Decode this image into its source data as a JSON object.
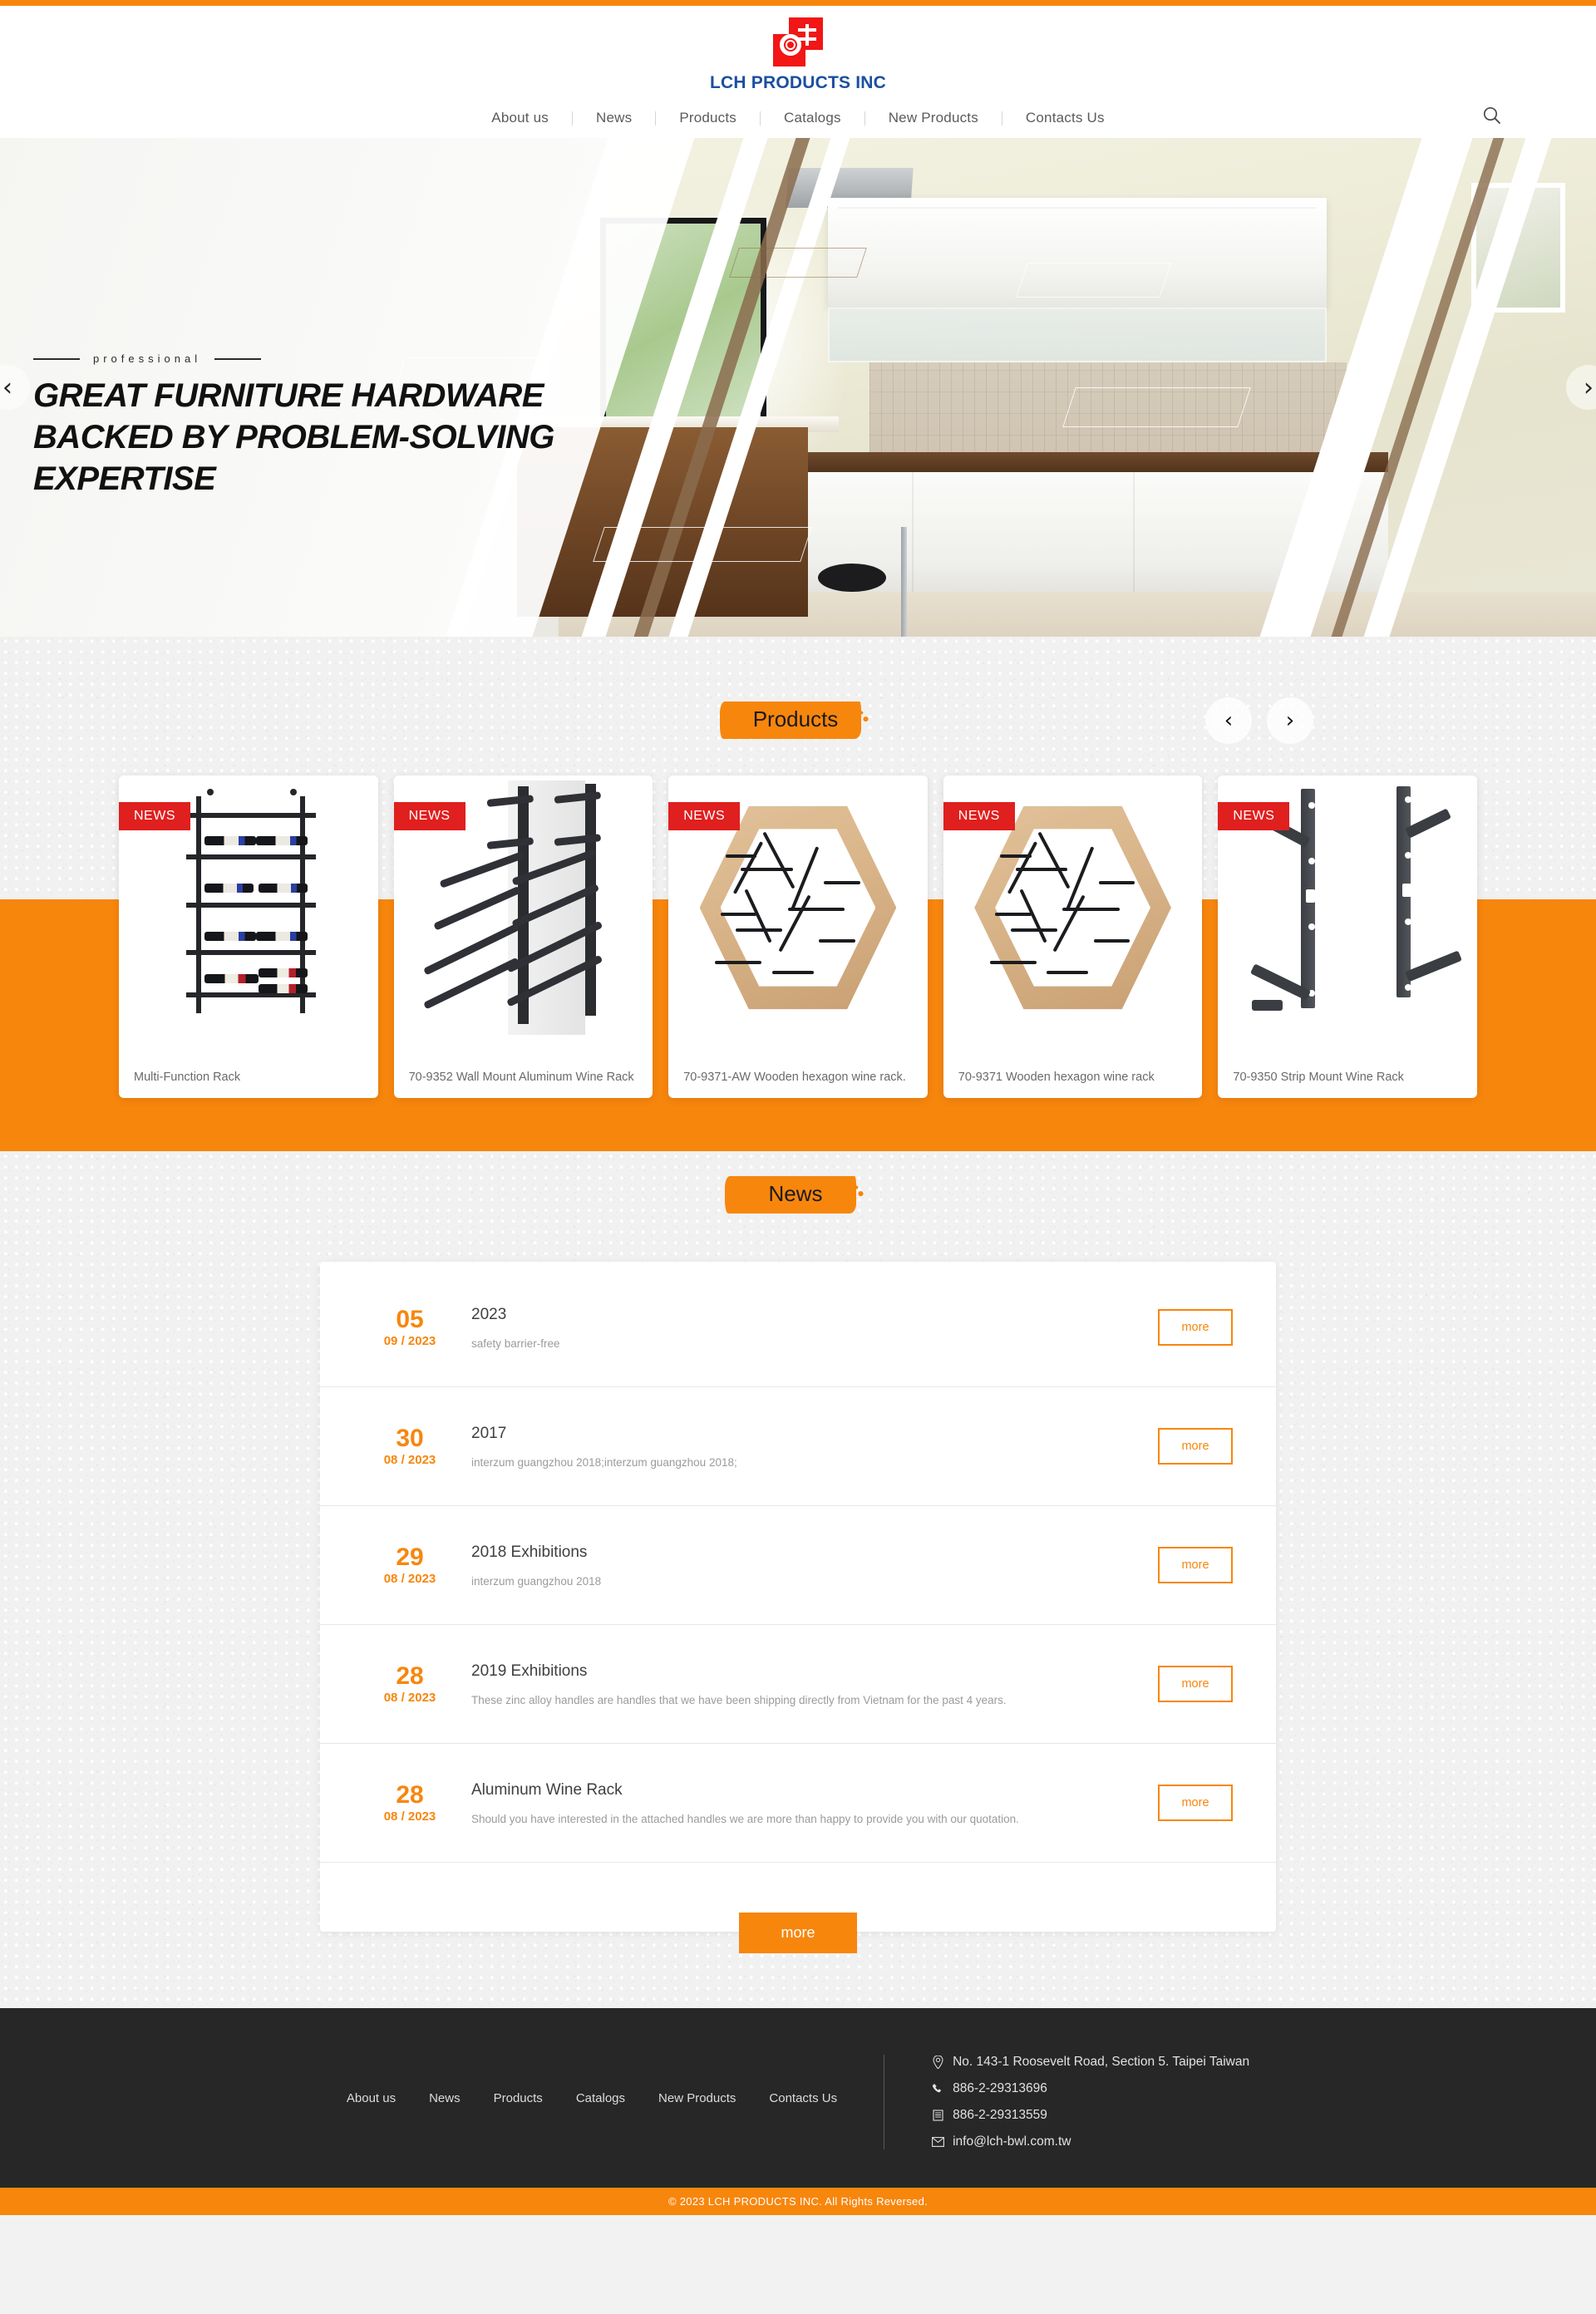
{
  "brand": {
    "name": "LCH PRODUCTS INC",
    "logo_red": "#f21616",
    "word_blue": "#1b4fa0"
  },
  "accent": {
    "orange": "#f7860d",
    "red_badge": "#e01f1f",
    "footer_dark": "#272727"
  },
  "nav": {
    "items": [
      {
        "label": "About us"
      },
      {
        "label": "News"
      },
      {
        "label": "Products"
      },
      {
        "label": "Catalogs"
      },
      {
        "label": "New Products"
      },
      {
        "label": "Contacts Us"
      }
    ],
    "search_icon": "search-icon"
  },
  "hero": {
    "kicker": "professional",
    "title": "GREAT FURNITURE HARDWARE BACKED BY PROBLEM-SOLVING EXPERTISE",
    "prev_icon": "chevron-left-icon",
    "next_icon": "chevron-right-icon"
  },
  "products": {
    "heading": "Products",
    "prev_icon": "chevron-left-icon",
    "next_icon": "chevron-right-icon",
    "items": [
      {
        "badge": "NEWS",
        "title": "Multi-Function Rack"
      },
      {
        "badge": "NEWS",
        "title": "70-9352 Wall Mount Aluminum Wine Rack"
      },
      {
        "badge": "NEWS",
        "title": "70-9371-AW Wooden hexagon wine rack."
      },
      {
        "badge": "NEWS",
        "title": "70-9371 Wooden hexagon wine rack"
      },
      {
        "badge": "NEWS",
        "title": "70-9350 Strip Mount Wine Rack"
      }
    ]
  },
  "news": {
    "heading": "News",
    "more_label": "more",
    "bottom_more_label": "more",
    "items": [
      {
        "day": "05",
        "monthyear": "09 / 2023",
        "title": "2023",
        "desc": "safety barrier-free",
        "more": "more"
      },
      {
        "day": "30",
        "monthyear": "08 / 2023",
        "title": "2017",
        "desc": "interzum guangzhou 2018;interzum guangzhou 2018;",
        "more": "more"
      },
      {
        "day": "29",
        "monthyear": "08 / 2023",
        "title": "2018 Exhibitions",
        "desc": "interzum guangzhou 2018",
        "more": "more"
      },
      {
        "day": "28",
        "monthyear": "08 / 2023",
        "title": "2019 Exhibitions",
        "desc": "These zinc alloy handles are handles that we have been shipping directly from Vietnam for the past 4 years.",
        "more": "more"
      },
      {
        "day": "28",
        "monthyear": "08 / 2023",
        "title": "Aluminum Wine Rack",
        "desc": "Should you have interested in the attached handles we are more than happy to provide you with our quotation.",
        "more": "more"
      }
    ]
  },
  "footer": {
    "nav": [
      {
        "label": "About us"
      },
      {
        "label": "News"
      },
      {
        "label": "Products"
      },
      {
        "label": "Catalogs"
      },
      {
        "label": "New Products"
      },
      {
        "label": "Contacts Us"
      }
    ],
    "contact": {
      "address": "No. 143-1 Roosevelt Road, Section 5. Taipei Taiwan",
      "phone": "886-2-29313696",
      "fax": "886-2-29313559",
      "email": "info@lch-bwl.com.tw",
      "address_icon": "location-pin-icon",
      "phone_icon": "phone-icon",
      "fax_icon": "fax-icon",
      "email_icon": "envelope-icon"
    },
    "copyright": "© 2023 LCH PRODUCTS INC. All Rights Reversed."
  }
}
